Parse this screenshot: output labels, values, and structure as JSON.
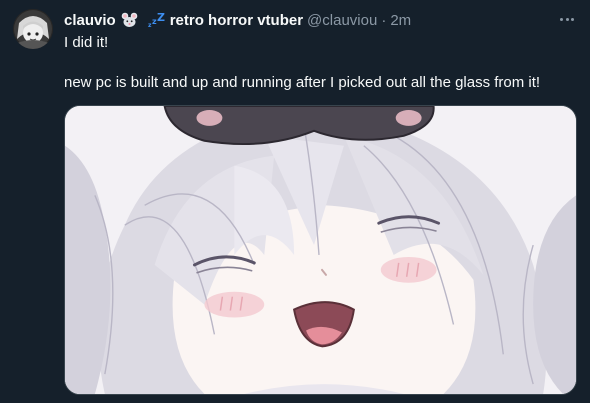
{
  "tweet": {
    "display_name": "clauvio",
    "name_suffix": "retro horror vtuber",
    "handle": "@clauviou",
    "separator": "·",
    "time": "2m",
    "text_line1": "I did it!",
    "text_line2": "new pc is built and up and running after I picked out all the glass from it!",
    "emojis": [
      "mouse-emoji",
      "sleeping-zzz-emoji"
    ],
    "media_description": "anime-style illustration of a grey-haired girl smiling with eyes closed and a sleep mask on her head"
  },
  "colors": {
    "background": "#15202b",
    "text_primary": "#f7f9f9",
    "text_secondary": "#8b98a5",
    "border": "#38444d",
    "zzz_blue": "#3d8ef0"
  }
}
